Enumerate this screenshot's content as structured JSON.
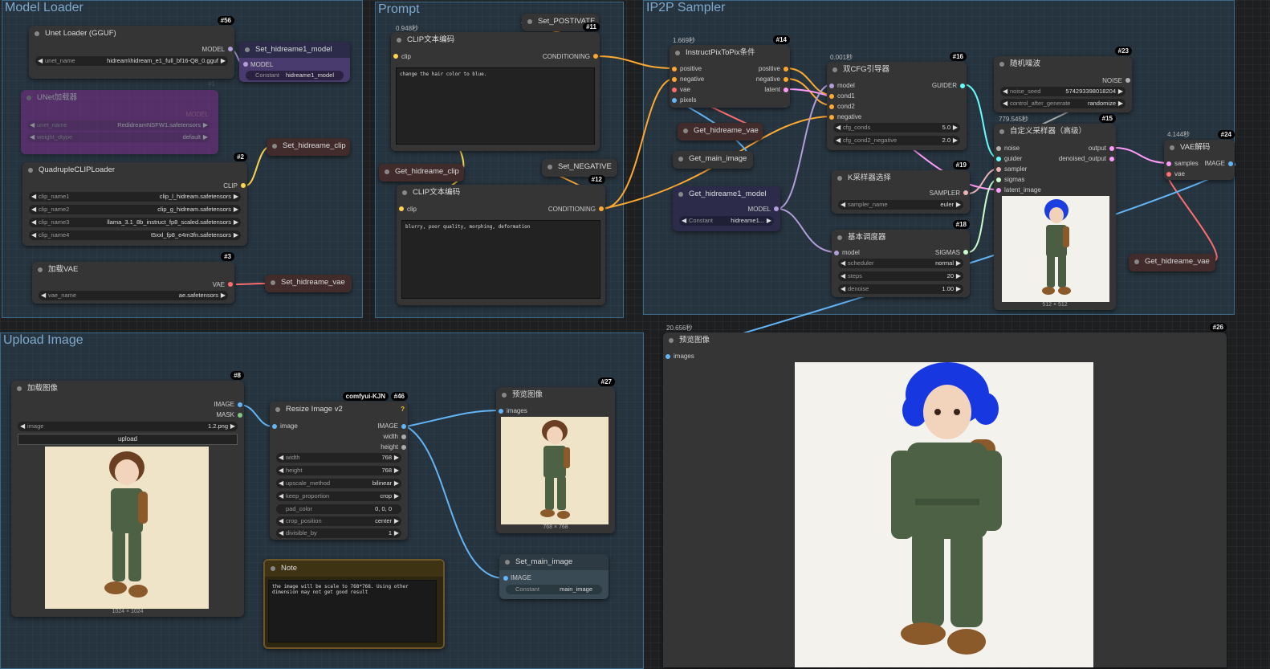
{
  "colors": {
    "model": "#b39ddb",
    "clip": "#ffd54f",
    "conditioning": "#ffa931",
    "vae": "#ff6e6e",
    "image": "#64b5f6",
    "latent": "#ff9cf9",
    "sigmas": "#cdffcd",
    "sampler": "#ecb4b4",
    "noise": "#b0b0b0",
    "guider": "#66ffff",
    "mask": "#81c784"
  },
  "groups": {
    "model_loader": "Model Loader",
    "prompt": "Prompt",
    "ip2p": "IP2P Sampler",
    "upload": "Upload Image"
  },
  "unet": {
    "title": "Unet Loader (GGUF)",
    "id": "#56",
    "out": "MODEL",
    "w_label": "unet_name",
    "w_value": "hidream\\hidream_e1_full_bf16-Q8_0.gguf"
  },
  "set_model": {
    "title": "Set_hidreame1_model",
    "in": "MODEL",
    "c_label": "Constant",
    "c_value": "hidreame1_model"
  },
  "unet_disabled": {
    "id": "#1",
    "title": "UNet加载器",
    "out": "MODEL",
    "w1_label": "unet_name",
    "w1_value": "RedidreamNSFW1.safetensors",
    "w2_label": "weight_dtype",
    "w2_value": "default"
  },
  "quad_clip": {
    "title": "QuadrupleCLIPLoader",
    "id": "#2",
    "out": "CLIP",
    "widgets": [
      {
        "label": "clip_name1",
        "value": "clip_l_hidream.safetensors"
      },
      {
        "label": "clip_name2",
        "value": "clip_g_hidream.safetensors"
      },
      {
        "label": "clip_name3",
        "value": "llama_3.1_8b_instruct_fp8_scaled.safetensors"
      },
      {
        "label": "clip_name4",
        "value": "t5xxl_fp8_e4m3fn.safetensors"
      }
    ]
  },
  "set_clip": {
    "title": "Set_hidreame_clip"
  },
  "vae_loader": {
    "title": "加载VAE",
    "id": "#3",
    "out": "VAE",
    "w_label": "vae_name",
    "w_value": "ae.safetensors"
  },
  "set_vae": {
    "title": "Set_hidreame_vae"
  },
  "set_positive": {
    "title": "Set_POSTIVATE"
  },
  "clip_pos": {
    "timer": "0.948秒",
    "title": "CLIP文本编码",
    "id": "#11",
    "in": "clip",
    "out": "CONDITIONING",
    "text": "change the hair color to blue."
  },
  "get_clip": {
    "title": "Get_hidreame_clip"
  },
  "set_negative": {
    "title": "Set_NEGATIVE"
  },
  "clip_neg": {
    "title": "CLIP文本编码",
    "id": "#12",
    "in": "clip",
    "out": "CONDITIONING",
    "text": "blurry, poor quality, morphing, deformation"
  },
  "ip2p_cond": {
    "timer": "1.669秒",
    "title": "InstructPixToPix条件",
    "id": "#14",
    "ins": [
      "positive",
      "negative",
      "vae",
      "pixels"
    ],
    "outs": [
      "positive",
      "negative",
      "latent"
    ]
  },
  "get_vae1": {
    "title": "Get_hidreame_vae"
  },
  "get_main_image": {
    "title": "Get_main_image"
  },
  "get_model": {
    "title": "Get_hidreame1_model",
    "out": "MODEL",
    "c_label": "Constant",
    "c_value": "hidreame1..."
  },
  "dual_cfg": {
    "timer": "0.001秒",
    "title": "双CFG引导器",
    "id": "#16",
    "ins": [
      "model",
      "cond1",
      "cond2",
      "negative"
    ],
    "out": "GUIDER",
    "w1_label": "cfg_conds",
    "w1_value": "5.0",
    "w2_label": "cfg_cond2_negative",
    "w2_value": "2.0"
  },
  "ksampler_select": {
    "title": "K采样器选择",
    "id": "#19",
    "out": "SAMPLER",
    "w_label": "sampler_name",
    "w_value": "euler"
  },
  "basic_sched": {
    "title": "基本调度器",
    "id": "#18",
    "in": "model",
    "out": "SIGMAS",
    "widgets": [
      {
        "label": "scheduler",
        "value": "normal"
      },
      {
        "label": "steps",
        "value": "20"
      },
      {
        "label": "denoise",
        "value": "1.00"
      }
    ]
  },
  "random_noise": {
    "title": "随机噪波",
    "id": "#23",
    "out": "NOISE",
    "w1_label": "noise_seed",
    "w1_value": "574293398018204",
    "w2_label": "control_after_generate",
    "w2_value": "randomize"
  },
  "custom_sampler": {
    "timer": "779.545秒",
    "title": "自定义采样器（高级）",
    "id": "#15",
    "ins": [
      "noise",
      "guider",
      "sampler",
      "sigmas",
      "latent_image"
    ],
    "outs": [
      "output",
      "denoised_output"
    ],
    "caption": "512 × 512"
  },
  "vae_decode": {
    "timer": "4.144秒",
    "title": "VAE解码",
    "id": "#24",
    "ins": [
      "samples",
      "vae"
    ],
    "out": "IMAGE"
  },
  "get_vae2": {
    "title": "Get_hidreame_vae"
  },
  "preview_big": {
    "timer": "20.656秒",
    "title": "预览图像",
    "id": "#26",
    "in": "images"
  },
  "load_image": {
    "title": "加载图像",
    "id": "#8",
    "outs": [
      "IMAGE",
      "MASK"
    ],
    "w_label": "image",
    "w_value": "1.2.png",
    "upload": "upload",
    "caption": "1024 × 1024"
  },
  "resize": {
    "title": "Resize Image v2",
    "id": "#46",
    "tag": "comfyui-KJN",
    "in": "image",
    "outs": [
      "IMAGE",
      "width",
      "height"
    ],
    "widgets": [
      {
        "label": "width",
        "value": "768"
      },
      {
        "label": "height",
        "value": "768"
      },
      {
        "label": "upscale_method",
        "value": "bilinear"
      },
      {
        "label": "keep_proportion",
        "value": "crop"
      },
      {
        "label": "pad_color",
        "value": "0, 0, 0"
      },
      {
        "label": "crop_position",
        "value": "center"
      },
      {
        "label": "divisible_by",
        "value": "1"
      }
    ]
  },
  "preview_small": {
    "title": "预览图像",
    "id": "#27",
    "in": "images",
    "caption": "768 × 768"
  },
  "set_main_image": {
    "title": "Set_main_image",
    "in": "IMAGE",
    "c_label": "Constant",
    "c_value": "main_image"
  },
  "note": {
    "title": "Note",
    "text": "the image will be scale to 768*768. Using other dimension may not get good result"
  }
}
